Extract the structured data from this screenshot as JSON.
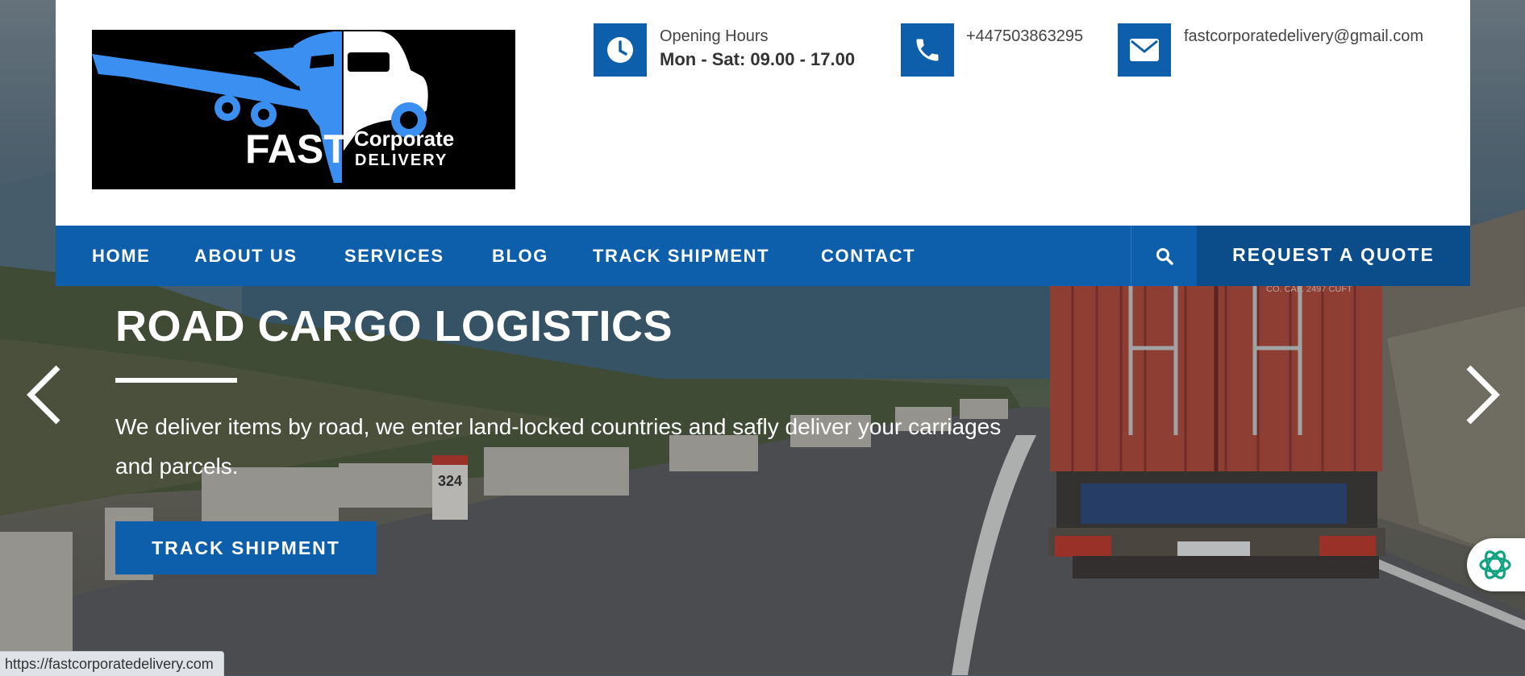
{
  "logo": {
    "word_fast": "FAST",
    "word_corporate": "Corporate",
    "word_delivery": "DELIVERY",
    "brand_blue": "#3b8ff0"
  },
  "contact": {
    "hours_label": "Opening Hours",
    "hours_value": "Mon - Sat: 09.00 - 17.00",
    "phone": "+447503863295",
    "email": "fastcorporatedelivery@gmail.com"
  },
  "nav": {
    "items": [
      {
        "label": "HOME"
      },
      {
        "label": "ABOUT US"
      },
      {
        "label": "SERVICES"
      },
      {
        "label": "BLOG"
      },
      {
        "label": "TRACK SHIPMENT"
      },
      {
        "label": "CONTACT"
      }
    ],
    "quote_label": "REQUEST A QUOTE"
  },
  "slide": {
    "title": "ROAD CARGO LOGISTICS",
    "text": "We deliver items by road, we enter land-locked countries and safly deliver your carriages and parcels.",
    "button_label": "TRACK SHIPMENT"
  },
  "scene": {
    "road_marker": "324",
    "container_label": "CO. CAP.   2497 CUFT"
  },
  "status_bar": {
    "url": "https://fastcorporatedelivery.com"
  },
  "colors": {
    "primary": "#0e5fab",
    "primary_dark": "#0b4c8a",
    "header_bg": "#ffffff",
    "chat_accent": "#10a37f"
  },
  "icons": {
    "hours": "clock-icon",
    "phone": "phone-icon",
    "email": "envelope-icon",
    "search": "search-icon",
    "prev": "chevron-left-icon",
    "next": "chevron-right-icon",
    "chat": "chat-assistant-icon"
  }
}
